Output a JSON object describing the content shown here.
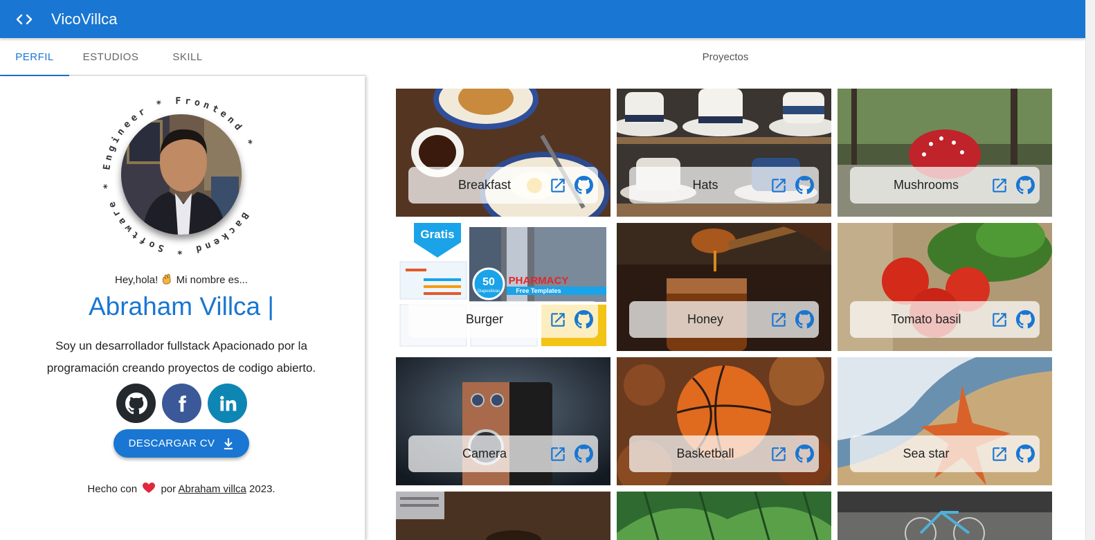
{
  "app": {
    "title": "VicoVillca"
  },
  "tabs": [
    {
      "label": "PERFIL",
      "active": true
    },
    {
      "label": "ESTUDIOS",
      "active": false
    },
    {
      "label": "SKILL",
      "active": false
    }
  ],
  "profile": {
    "ring_text": "Backend * Software * Engineer * Frontend *",
    "greeting_before": "Hey,hola!",
    "greeting_after": "Mi nombre es...",
    "name": "Abraham Villca |",
    "bio": "Soy un desarrollador fullstack Apacionado por la programación creando proyectos de codigo abierto.",
    "socials": [
      {
        "icon": "github-icon"
      },
      {
        "icon": "facebook-icon"
      },
      {
        "icon": "linkedin-icon"
      }
    ],
    "cv_button": "DESCARGAR CV",
    "footer": {
      "prefix": "Hecho con",
      "middle": "por",
      "author": "Abraham villca",
      "year": "2023."
    }
  },
  "projects": {
    "title": "Proyectos",
    "items": [
      {
        "title": "Breakfast"
      },
      {
        "title": "Hats"
      },
      {
        "title": "Mushrooms"
      },
      {
        "title": "Burger",
        "badge": "Gratis",
        "promo_number": "50",
        "promo_sub": "Diapositivas",
        "promo_title": "PHARMACY",
        "promo_caption": "Free Templates"
      },
      {
        "title": "Honey"
      },
      {
        "title": "Tomato basil"
      },
      {
        "title": "Camera"
      },
      {
        "title": "Basketball"
      },
      {
        "title": "Sea star"
      },
      {
        "title": ""
      },
      {
        "title": ""
      },
      {
        "title": ""
      }
    ]
  },
  "colors": {
    "primary": "#1976d2",
    "github": "#24292e",
    "facebook": "#3b5998",
    "linkedin": "#0e86b4"
  }
}
